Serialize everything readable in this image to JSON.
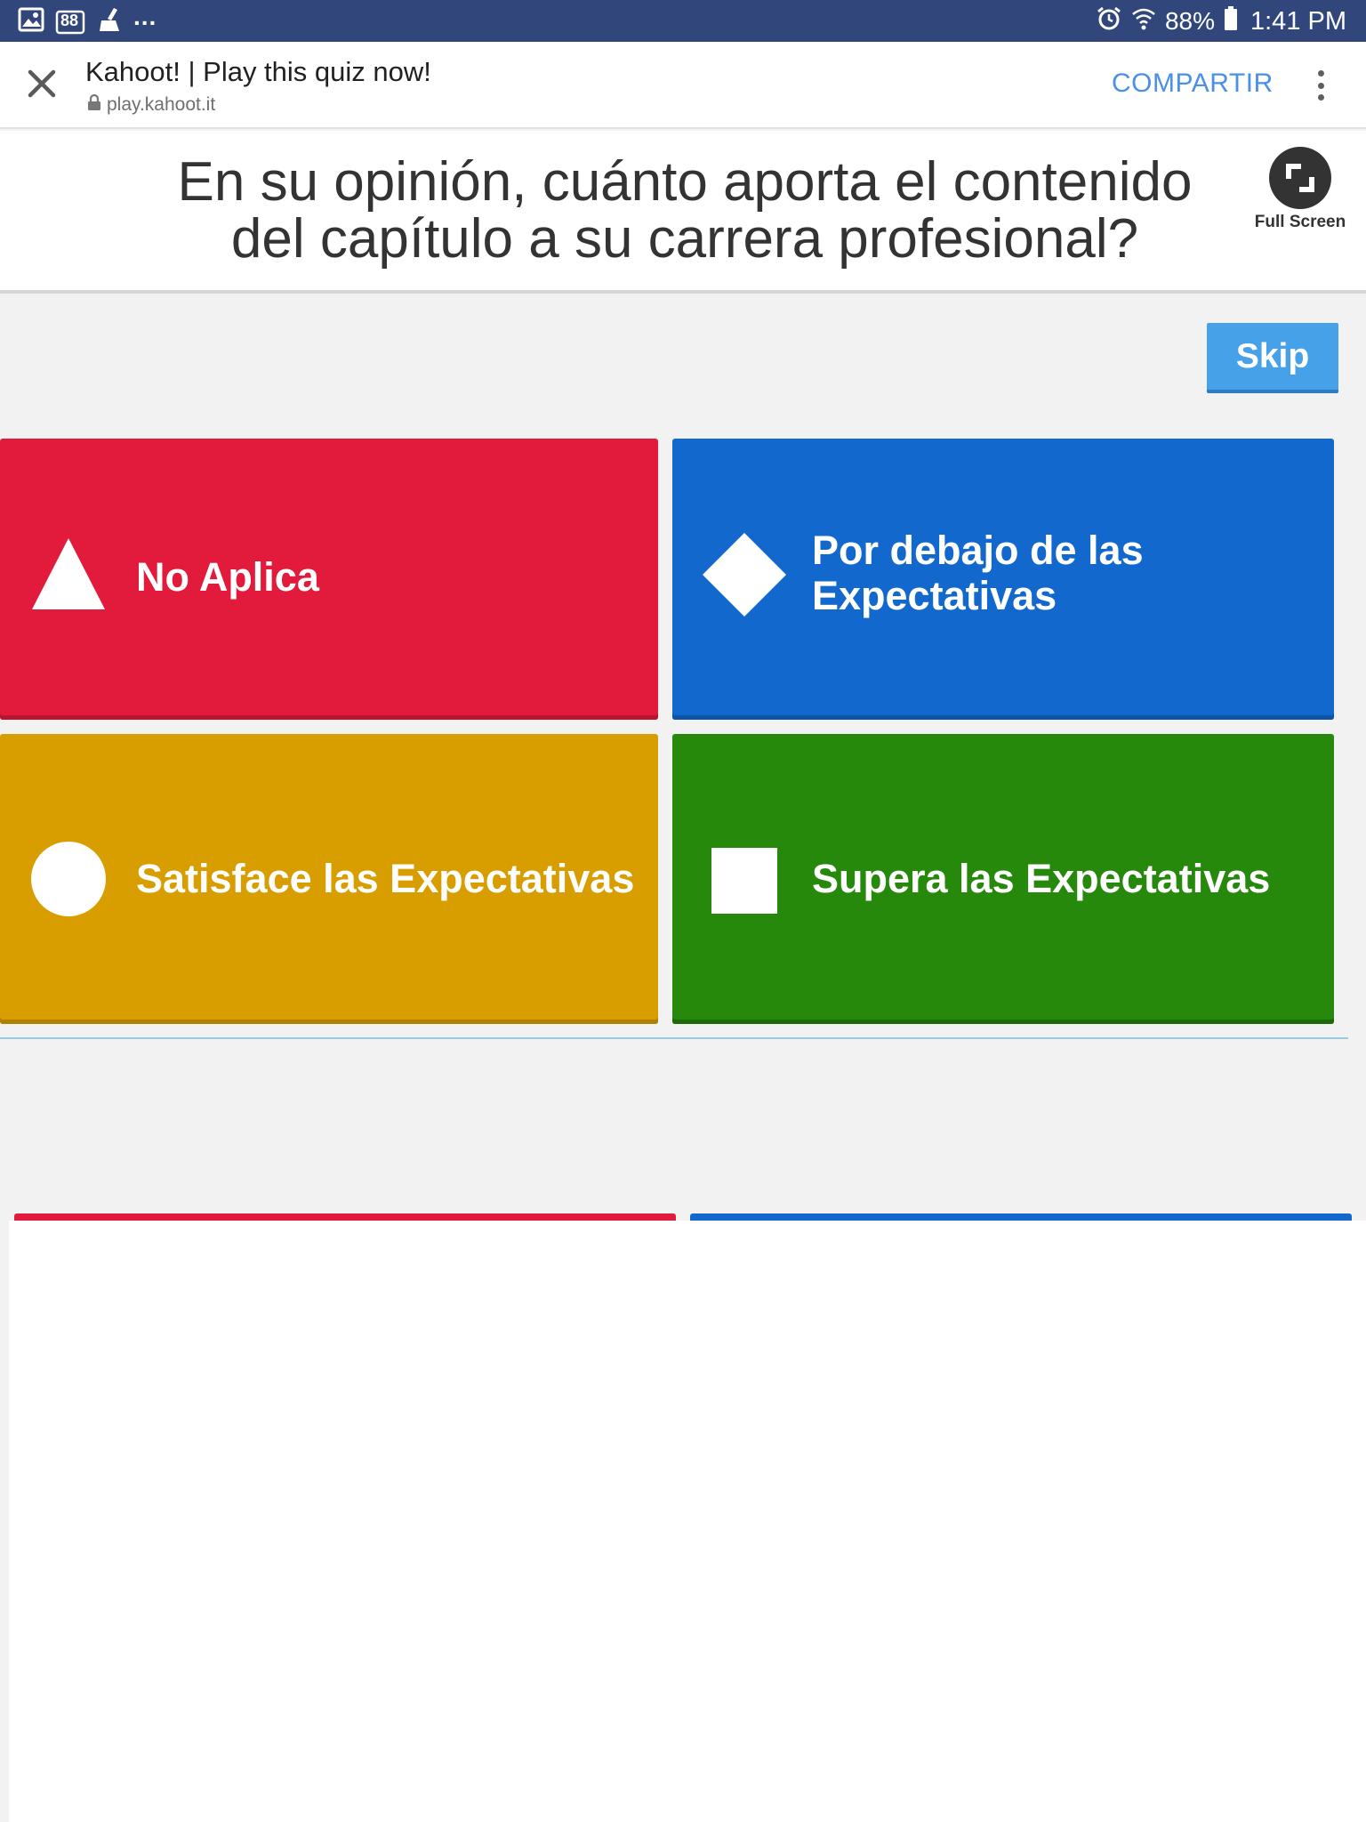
{
  "status_bar": {
    "dots": "...",
    "badge": "88",
    "battery": "88%",
    "time": "1:41 PM",
    "background": "#31467b"
  },
  "browser": {
    "title": "Kahoot! | Play this quiz now!",
    "url": "play.kahoot.it",
    "share_label": "COMPARTIR",
    "share_color": "#4a8fe8"
  },
  "question": {
    "line1": "En su opinión, cuánto aporta el contenido",
    "line2": "del capítulo a su carrera profesional?",
    "fullscreen_label": "Full Screen"
  },
  "skip_label": "Skip",
  "answers": [
    {
      "shape": "triangle-icon",
      "label": "No Aplica",
      "color": "#e21b3c"
    },
    {
      "shape": "diamond-icon",
      "label_line1": "Por debajo de las",
      "label_line2": "Expectativas",
      "color": "#1368ce"
    },
    {
      "shape": "circle-icon",
      "label": "Satisface las Expectativas",
      "color": "#d89e00"
    },
    {
      "shape": "square-icon",
      "label": "Supera las Expectativas",
      "color": "#26890c"
    }
  ]
}
